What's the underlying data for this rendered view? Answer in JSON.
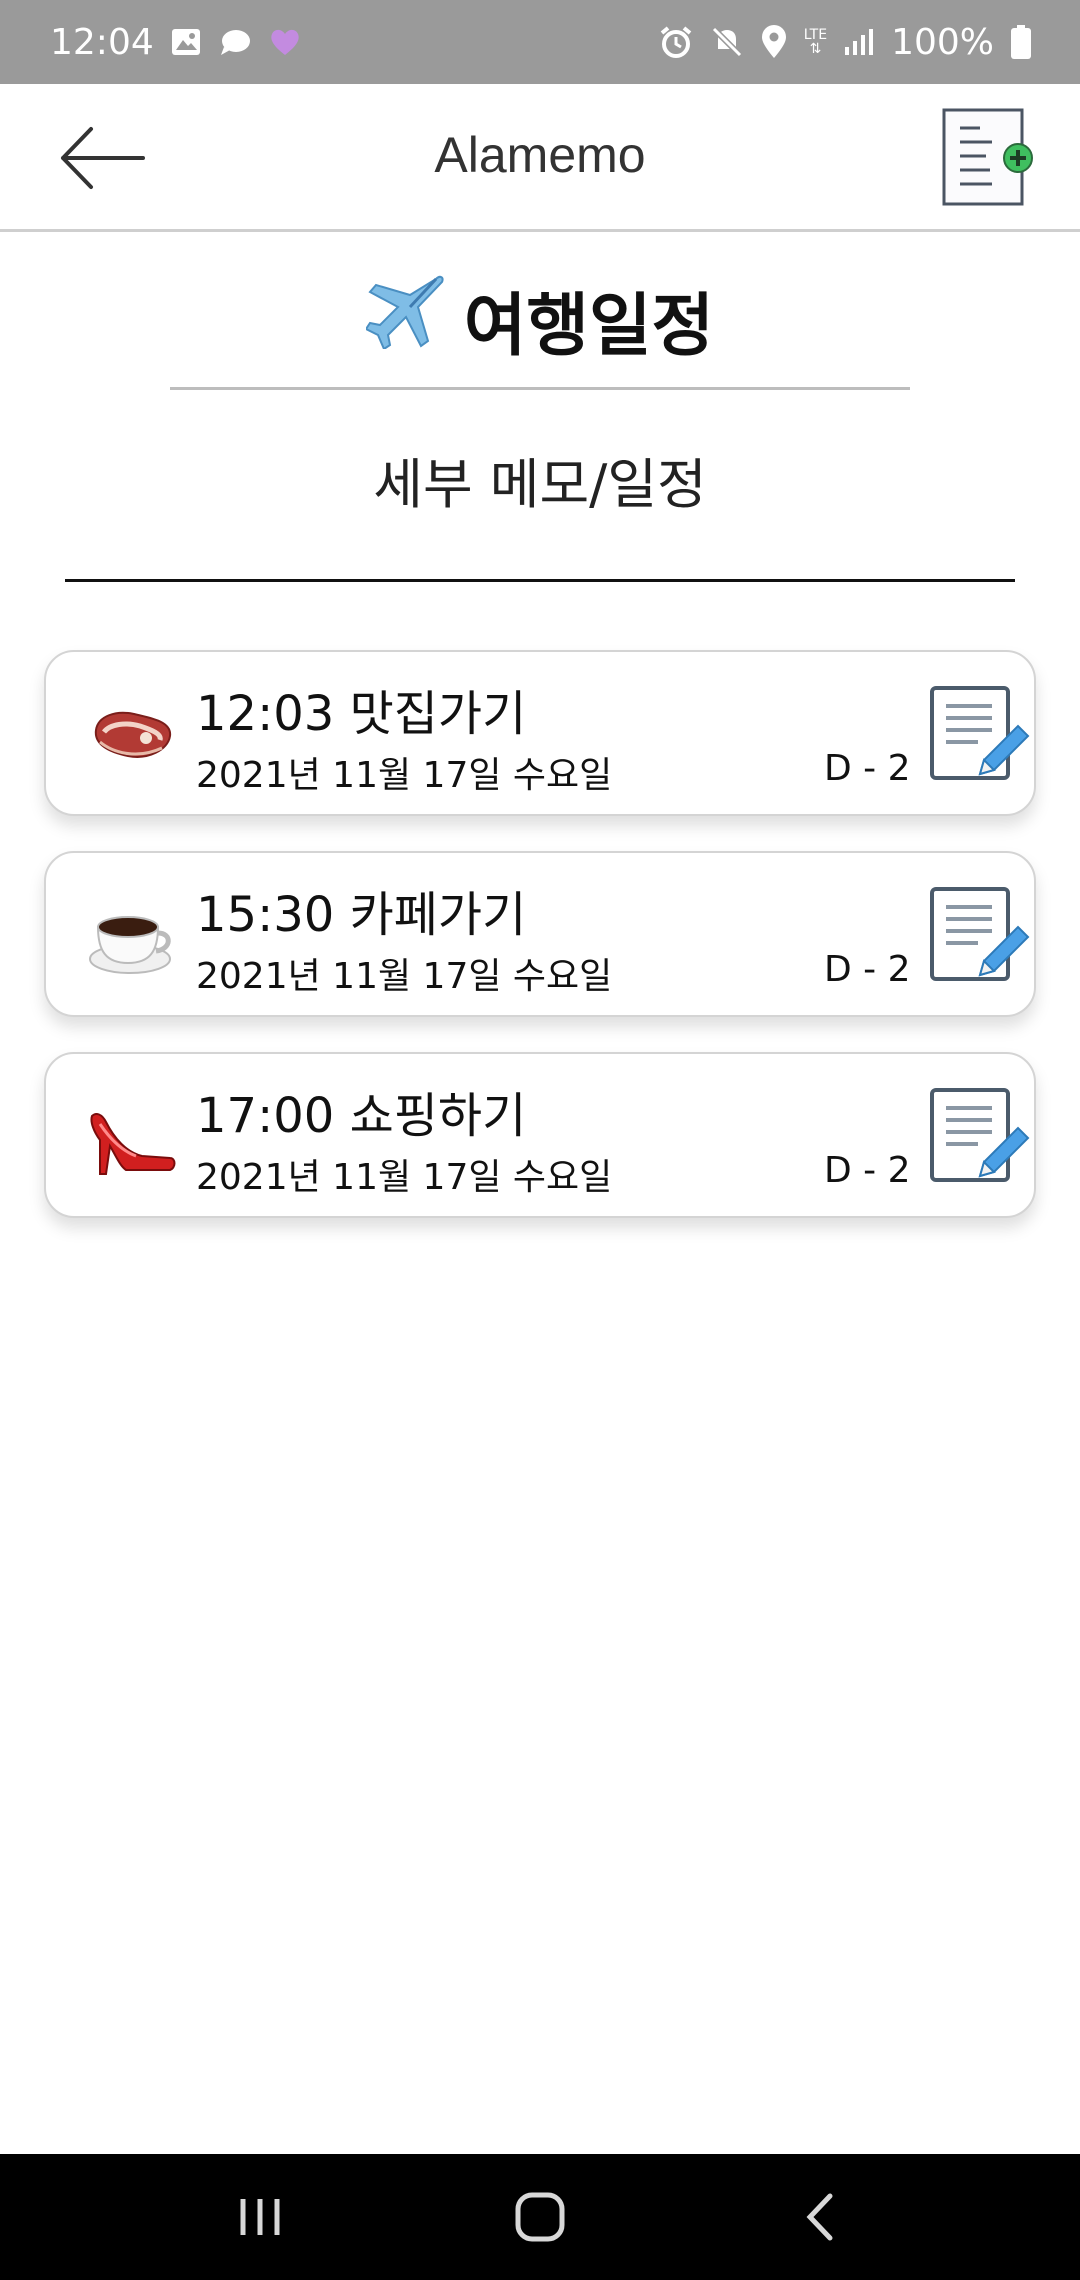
{
  "status_bar": {
    "time": "12:04",
    "battery": "100%",
    "network": "LTE",
    "left_icons": [
      "image-icon",
      "chat-bubble-icon",
      "heart-icon"
    ],
    "right_icons": [
      "alarm-icon",
      "mute-icon",
      "location-icon",
      "lte-icon",
      "signal-icon",
      "battery-icon"
    ],
    "heart_color": "#c38be0"
  },
  "app_bar": {
    "title": "Alamemo",
    "back_icon": "arrow-left-icon",
    "action_icon": "add-memo-icon"
  },
  "page": {
    "heading_icon": "airplane-icon",
    "heading": "여행일정",
    "subheading": "세부 메모/일정"
  },
  "schedule": [
    {
      "icon": "steak-icon",
      "title": "12:03 맛집가기",
      "date": "2021년 11월 17일 수요일",
      "dday": "D - 2"
    },
    {
      "icon": "coffee-icon",
      "title": "15:30 카페가기",
      "date": "2021년 11월 17일 수요일",
      "dday": "D - 2"
    },
    {
      "icon": "high-heel-icon",
      "title": "17:00 쇼핑하기",
      "date": "2021년 11월 17일 수요일",
      "dday": "D - 2"
    }
  ],
  "nav_bar": {
    "items": [
      "recent-apps-icon",
      "home-icon",
      "back-icon"
    ]
  },
  "colors": {
    "status_bar_bg": "#9a9a9a",
    "edit_pencil": "#4aa0e6",
    "add_badge": "#3fbf5f"
  }
}
